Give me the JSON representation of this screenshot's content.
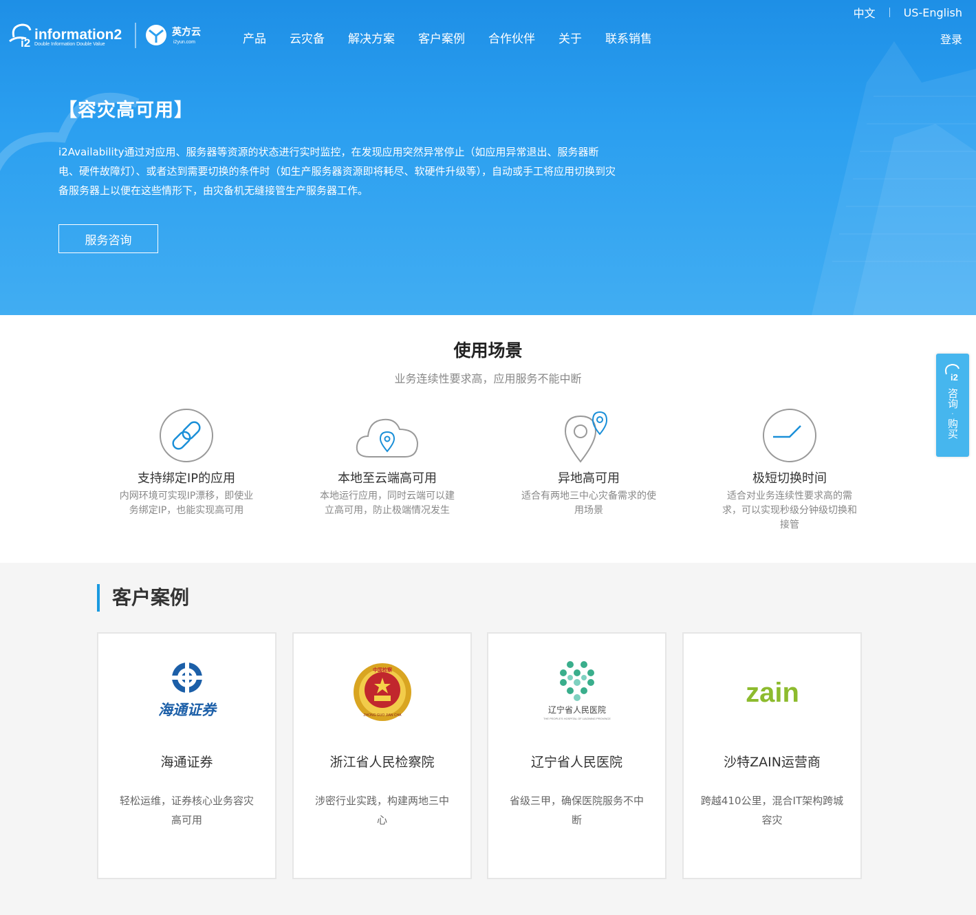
{
  "brand": {
    "logo_text": "information2",
    "logo_tagline": "Double Information Double Value",
    "logo_mark": "i2",
    "partner_name": "英方云",
    "partner_domain": "i2yun.com"
  },
  "nav": {
    "items": [
      "产品",
      "云灾备",
      "解决方案",
      "客户案例",
      "合作伙伴",
      "关于",
      "联系销售"
    ]
  },
  "lang": {
    "zh": "中文",
    "en": "US-English"
  },
  "login": "登录",
  "hero": {
    "title": "【容灾高可用】",
    "description": "i2Availability通过对应用、服务器等资源的状态进行实时监控，在发现应用突然异常停止（如应用异常退出、服务器断电、硬件故障灯）、或者达到需要切换的条件时（如生产服务器资源即将耗尽、软硬件升级等），自动或手工将应用切换到灾备服务器上以便在这些情形下，由灾备机无缝接管生产服务器工作。",
    "button": "服务咨询"
  },
  "scenarios": {
    "title": "使用场景",
    "subtitle": "业务连续性要求高，应用服务不能中断",
    "items": [
      {
        "title": "支持绑定IP的应用",
        "desc": "内网环境可实现IP漂移，即使业务绑定IP，也能实现高可用",
        "icon": "link-icon"
      },
      {
        "title": "本地至云端高可用",
        "desc": "本地运行应用，同时云端可以建立高可用，防止极端情况发生",
        "icon": "cloud-location-icon"
      },
      {
        "title": "异地高可用",
        "desc": "适合有两地三中心灾备需求的使用场景",
        "icon": "map-pin-icon"
      },
      {
        "title": "极短切换时间",
        "desc": "适合对业务连续性要求高的需求，可以实现秒级分钟级切换和接管",
        "icon": "clock-icon"
      }
    ]
  },
  "cases": {
    "title": "客户案例",
    "items": [
      {
        "name": "海通证券",
        "desc": "轻松运维，证券核心业务容灾高可用",
        "logo_text": "海通证券"
      },
      {
        "name": "浙江省人民检察院",
        "desc": "涉密行业实践，构建两地三中心",
        "logo_text": "中国检察",
        "logo_ring_text": "ZHONG GUO JIAN CHA"
      },
      {
        "name": "辽宁省人民医院",
        "desc": "省级三甲，确保医院服务不中断",
        "logo_text": "辽宁省人民医院",
        "logo_subtext": "THE PEOPLE'S HOSPITAL OF LIAONING PROVINCE"
      },
      {
        "name": "沙特ZAIN运营商",
        "desc": "跨越410公里，混合IT架构跨城容灾",
        "logo_text": "zain"
      }
    ]
  },
  "side": {
    "mark": "i2",
    "line1": "咨询",
    "dot": "·",
    "line2": "购买"
  },
  "colors": {
    "hero_blue": "#2b9ff0",
    "accent": "#1a9ae0",
    "side": "#46b6ee",
    "zain_green": "#8dbb2e"
  }
}
